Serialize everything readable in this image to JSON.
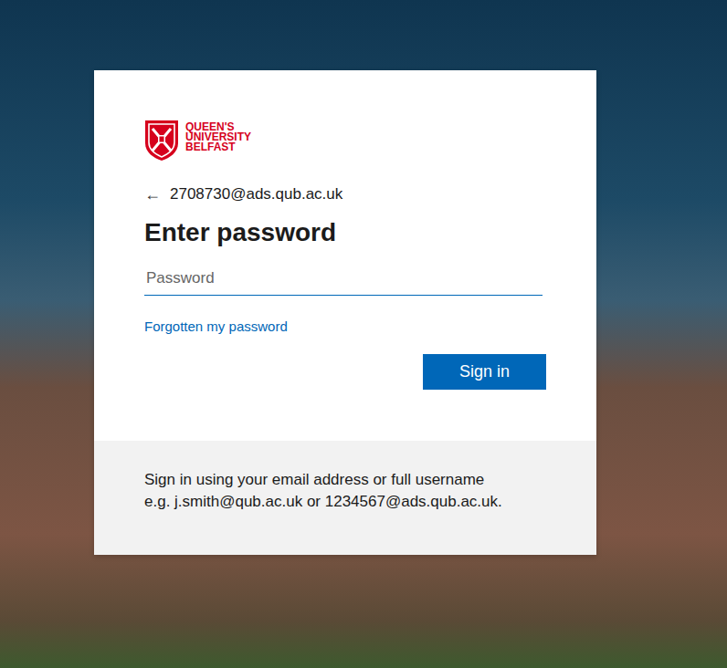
{
  "logo": {
    "lines": [
      "QUEEN'S",
      "UNIVERSITY",
      "BELFAST"
    ]
  },
  "identity": {
    "back_icon": "←",
    "email": "2708730@ads.qub.ac.uk"
  },
  "title": "Enter password",
  "password": {
    "placeholder": "Password",
    "value": ""
  },
  "links": [
    "Forgotten my password"
  ],
  "buttons": [
    "Sign in"
  ],
  "footer": {
    "lines": [
      "Sign in using your email address or full username",
      "e.g. j.smith@qub.ac.uk or 1234567@ads.qub.ac.uk."
    ]
  }
}
